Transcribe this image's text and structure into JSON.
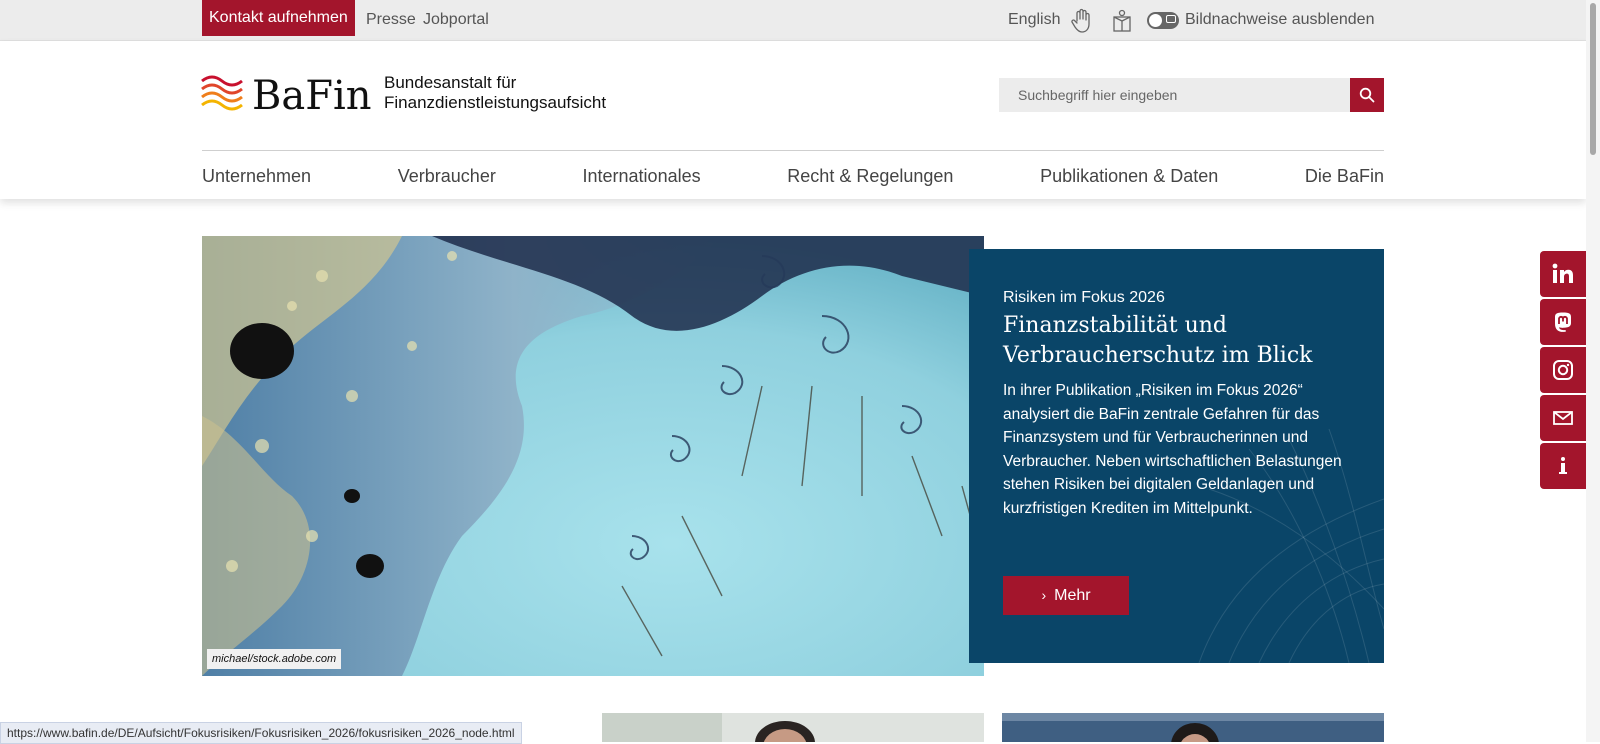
{
  "topbar": {
    "contact_label": "Kontakt aufnehmen",
    "links": [
      "Presse",
      "Jobportal"
    ],
    "language_label": "English",
    "sign_language_icon": "hand-icon",
    "easy_language_icon": "easy-language-icon",
    "image_credits_toggle_label": "Bildnachweise ausblenden"
  },
  "header": {
    "logo_name": "BaFin",
    "logo_subtitle_line1": "Bundesanstalt für",
    "logo_subtitle_line2": "Finanzdienstleistungsaufsicht",
    "search_placeholder": "Suchbegriff hier eingeben",
    "search_icon": "search-icon"
  },
  "nav": {
    "items": [
      "Unternehmen",
      "Verbraucher",
      "Internationales",
      "Recht & Regelungen",
      "Publikationen & Daten",
      "Die BaFin"
    ]
  },
  "hero": {
    "image_credit": "michael/stock.adobe.com",
    "kicker": "Risiken im Fokus 2026",
    "title": "Finanzstabilität und Verbraucher­schutz im Blick",
    "text": "In ihrer Publikation „Risiken im Fokus 2026“ analysiert die BaFin zentrale Gefahren für das Finanzsystem und für Verbraucherinnen und Verbraucher. Neben wirtschaftlichen Belastungen stehen Risiken bei digitalen Geldanlagen und kurzfristigen Krediten im Mittelpunkt.",
    "button_label": "Mehr"
  },
  "social": [
    "linkedin-icon",
    "mastodon-icon",
    "instagram-icon",
    "mail-icon",
    "info-icon"
  ],
  "status_url": "https://www.bafin.de/DE/Aufsicht/Fokusrisiken/Fokusrisiken_2026/fokusrisiken_2026_node.html",
  "colors": {
    "brand_red": "#a3152c",
    "teaser_blue": "#0a4568",
    "topbar_bg": "#ececec"
  }
}
